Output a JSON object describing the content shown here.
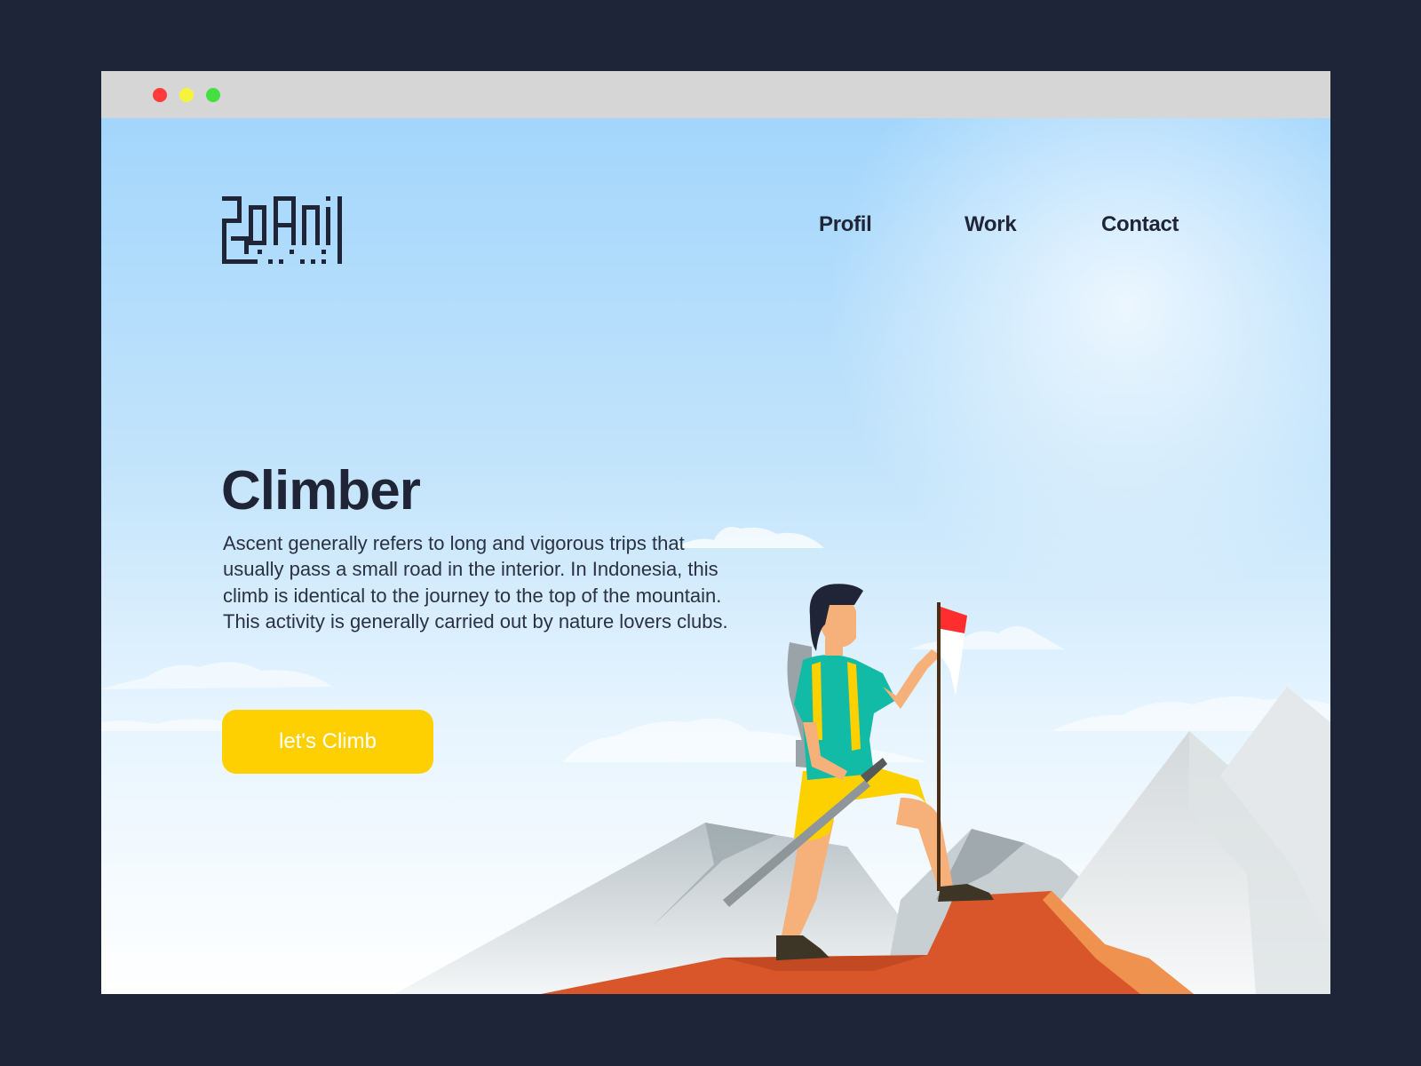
{
  "window": {
    "controls": [
      "close",
      "minimize",
      "maximize"
    ]
  },
  "header": {
    "logo_icon": "kufic-square-logo-icon",
    "nav": [
      {
        "label": "Profil"
      },
      {
        "label": "Work"
      },
      {
        "label": "Contact"
      }
    ]
  },
  "hero": {
    "title": "Climber",
    "description": "Ascent generally refers to long and vigorous trips that usually pass a small road in the interior. In Indonesia, this climb is identical to the journey to the top of the mountain. This activity is generally carried out by nature lovers clubs.",
    "cta_label": "let's Climb"
  },
  "illustration": {
    "subject": "climber-with-flag-illustration",
    "flag_colors": [
      "#ff3b3b",
      "#ffffff"
    ]
  },
  "colors": {
    "background": "#1e2538",
    "text": "#1f2536",
    "accent": "#ffd001",
    "sky_top": "#a3d6fc",
    "cliff": "#d9562b"
  }
}
